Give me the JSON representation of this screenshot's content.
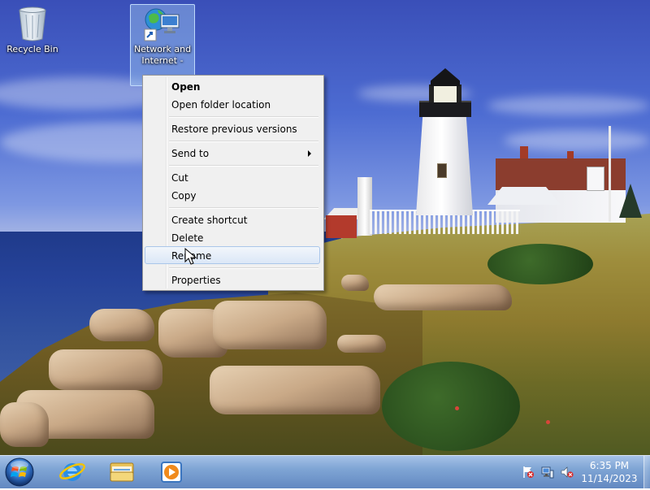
{
  "desktop": {
    "icons": [
      {
        "label": "Recycle Bin",
        "icon": "recycle-bin-icon"
      },
      {
        "label": "Network and Internet - ...",
        "label_line1": "Network and",
        "label_line2": "Internet -",
        "icon": "network-shortcut-icon",
        "selected": true
      }
    ]
  },
  "context_menu": {
    "items": [
      {
        "label": "Open",
        "bold": true
      },
      {
        "label": "Open folder location"
      },
      {
        "label": "Restore previous versions"
      },
      {
        "label": "Send to",
        "submenu": true
      },
      {
        "label": "Cut"
      },
      {
        "label": "Copy"
      },
      {
        "label": "Create shortcut"
      },
      {
        "label": "Delete"
      },
      {
        "label": "Rename",
        "hovered": true
      },
      {
        "label": "Properties"
      }
    ]
  },
  "taskbar": {
    "pinned": [
      {
        "name": "Internet Explorer",
        "icon": "internet-explorer-icon"
      },
      {
        "name": "Windows Explorer",
        "icon": "folder-icon"
      },
      {
        "name": "Windows Media Player",
        "icon": "media-player-icon"
      }
    ],
    "tray": {
      "icons": [
        "action-center-flag-icon",
        "network-icon",
        "volume-muted-icon"
      ],
      "time": "6:35 PM",
      "date": "11/14/2023"
    }
  },
  "colors": {
    "menu_bg": "#f0f0f0",
    "menu_hover": "#dbe7f7",
    "taskbar": "#7ea2d2",
    "selection": "#a0c8f0"
  }
}
